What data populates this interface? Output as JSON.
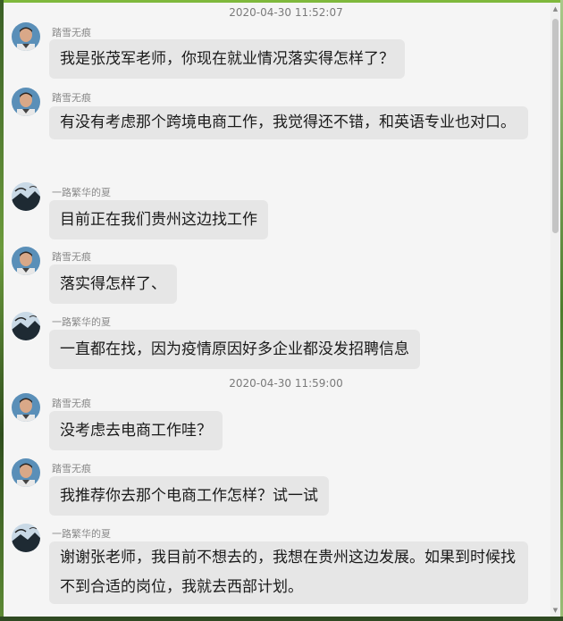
{
  "chat": {
    "timestamps": [
      "2020-04-30 11:52:07",
      "2020-04-30 11:59:00"
    ],
    "messages": [
      {
        "sender": "踏雪无痕",
        "avatar": "teacher-avatar",
        "text": "我是张茂军老师，你现在就业情况落实得怎样了？"
      },
      {
        "sender": "踏雪无痕",
        "avatar": "teacher-avatar",
        "text": "有没有考虑那个跨境电商工作，我觉得还不错，和英语专业也对口。"
      },
      {
        "sender": "一路繁华的夏",
        "avatar": "student-avatar",
        "text": "目前正在我们贵州这边找工作"
      },
      {
        "sender": "踏雪无痕",
        "avatar": "teacher-avatar",
        "text": "落实得怎样了、"
      },
      {
        "sender": "一路繁华的夏",
        "avatar": "student-avatar",
        "text": "一直都在找，因为疫情原因好多企业都没发招聘信息"
      },
      {
        "sender": "踏雪无痕",
        "avatar": "teacher-avatar",
        "text": "没考虑去电商工作哇？"
      },
      {
        "sender": "踏雪无痕",
        "avatar": "teacher-avatar",
        "text": "我推荐你去那个电商工作怎样？试一试"
      },
      {
        "sender": "一路繁华的夏",
        "avatar": "student-avatar",
        "text": "谢谢张老师，我目前不想去的，我想在贵州这边发展。如果到时候找不到合适的岗位，我就去西部计划。"
      }
    ]
  },
  "scrollbar": {
    "up_icon": "arrow-up-icon",
    "down_icon": "arrow-down-icon"
  },
  "colors": {
    "bubble": "#e6e6e6",
    "background": "#f5f5f5",
    "timestamp": "#7a7a7a"
  }
}
